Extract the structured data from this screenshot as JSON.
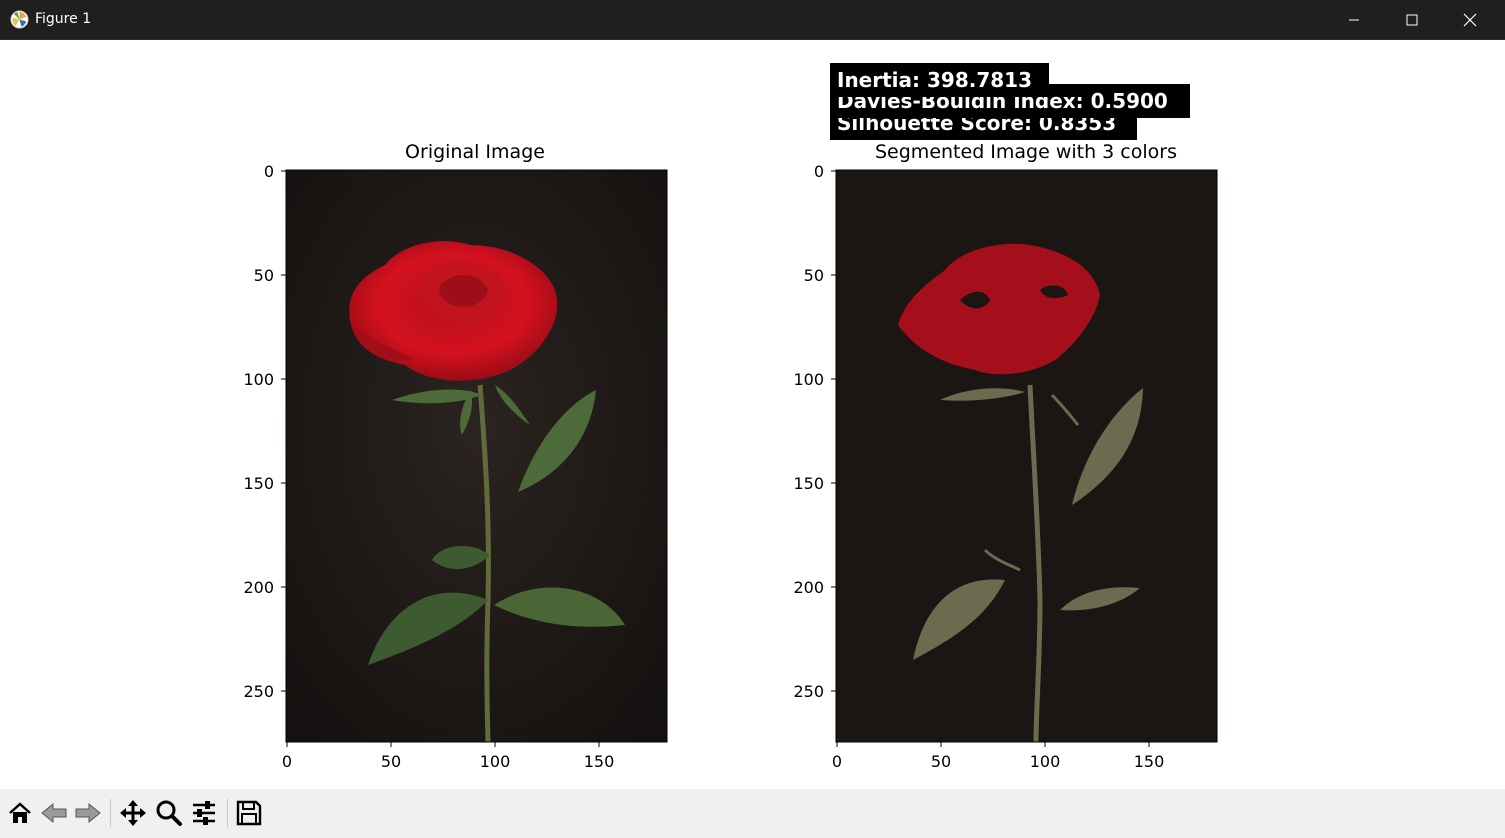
{
  "window": {
    "title": "Figure 1"
  },
  "plots": [
    {
      "title": "Original Image",
      "x_ticks": [
        "0",
        "50",
        "100",
        "150"
      ],
      "y_ticks": [
        "0",
        "50",
        "100",
        "150",
        "200",
        "250"
      ]
    },
    {
      "title": "Segmented Image with 3 colors",
      "x_ticks": [
        "0",
        "50",
        "100",
        "150"
      ],
      "y_ticks": [
        "0",
        "50",
        "100",
        "150",
        "200",
        "250"
      ]
    }
  ],
  "metrics": {
    "inertia": "Inertia: 398.7813",
    "davies_bouldin": "Davies-Bouldin Index: 0.5900",
    "silhouette": "Silhouette Score: 0.8353"
  },
  "segment_colors": {
    "background": "#1b1513",
    "petal": "#a50f1c",
    "stem_leaf": "#6b6b4f"
  },
  "toolbar": {
    "buttons": [
      "home-icon",
      "back-icon",
      "forward-icon",
      "pan-icon",
      "zoom-icon",
      "configure-icon",
      "save-icon"
    ]
  }
}
